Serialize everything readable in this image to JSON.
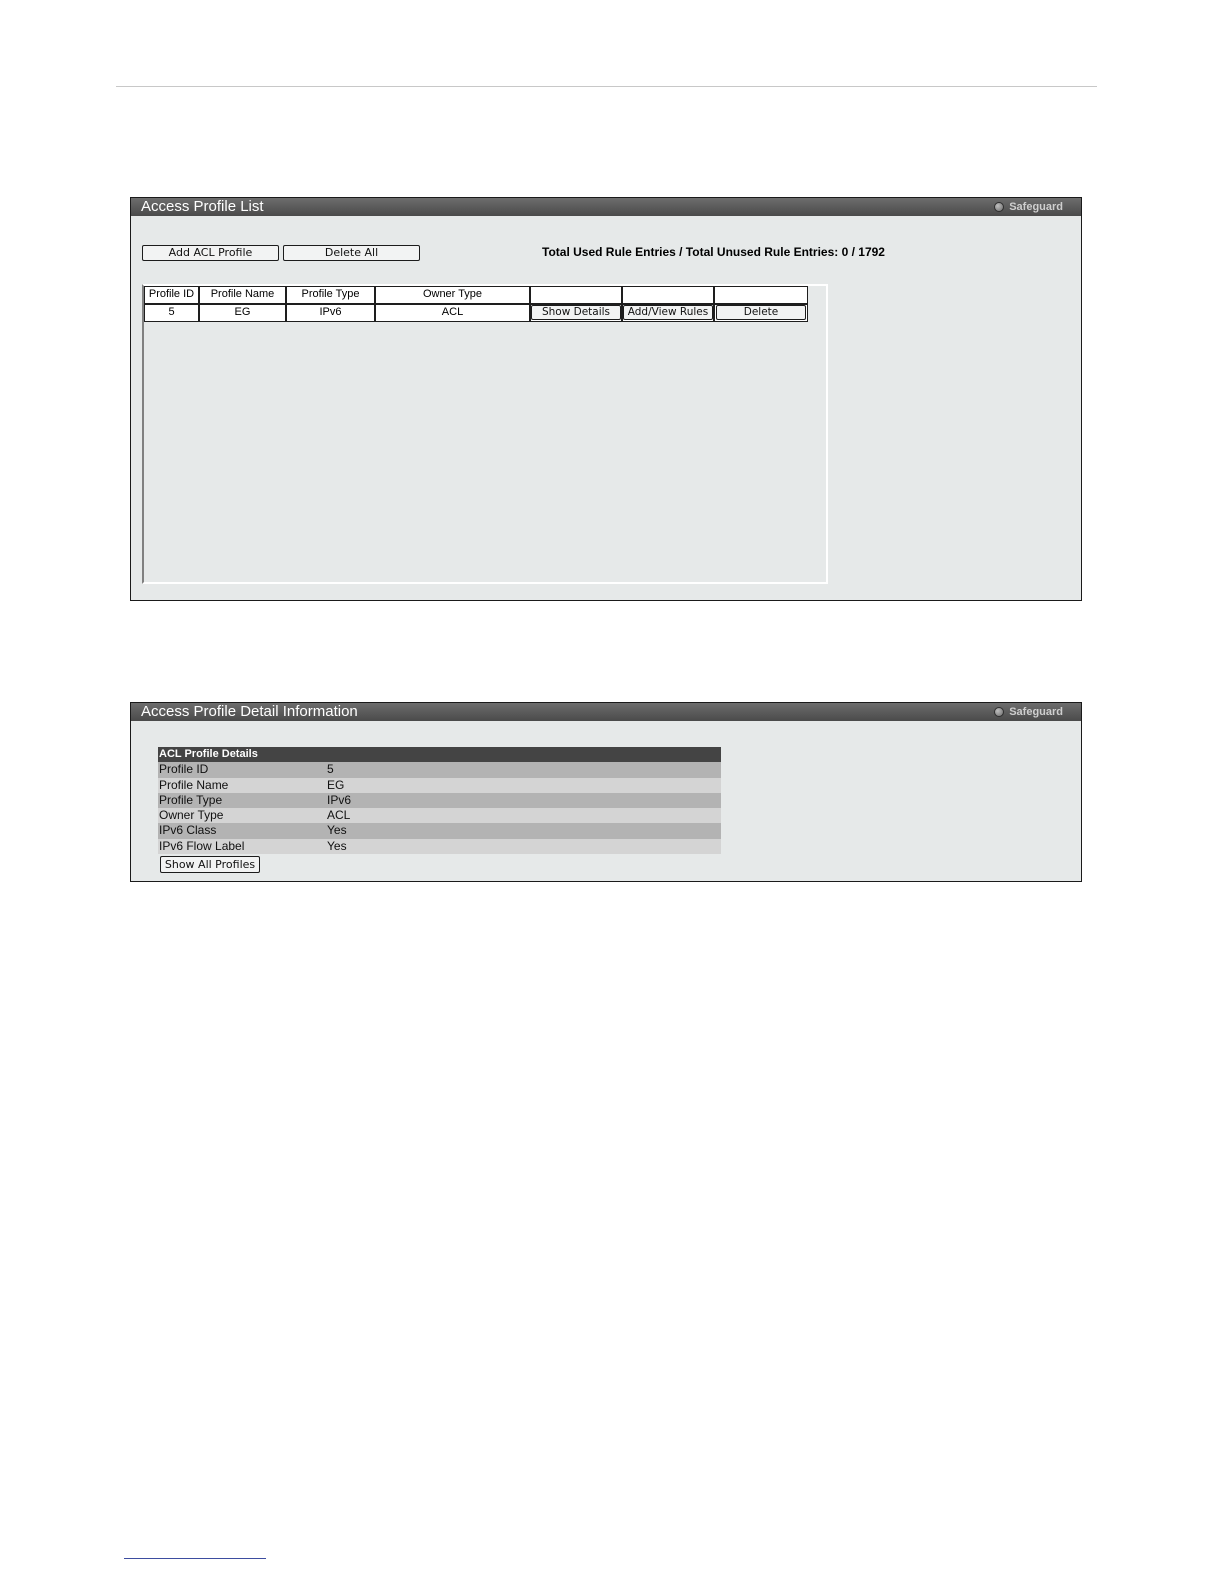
{
  "access_profile_list": {
    "title": "Access Profile List",
    "safeguard_label": "Safeguard",
    "add_button": "Add ACL Profile",
    "delete_all_button": "Delete All",
    "totals_text": "Total Used Rule Entries / Total Unused Rule Entries: 0 / 1792",
    "columns": [
      "Profile ID",
      "Profile Name",
      "Profile Type",
      "Owner Type",
      "",
      "",
      ""
    ],
    "rows": [
      {
        "profile_id": "5",
        "profile_name": "EG",
        "profile_type": "IPv6",
        "owner_type": "ACL",
        "show_details": "Show Details",
        "add_view_rules": "Add/View Rules",
        "delete": "Delete"
      }
    ]
  },
  "detail_panel": {
    "title": "Access Profile Detail Information",
    "safeguard_label": "Safeguard",
    "section_header": "ACL Profile Details",
    "rows": [
      {
        "label": "Profile ID",
        "value": "5"
      },
      {
        "label": "Profile Name",
        "value": "EG"
      },
      {
        "label": "Profile Type",
        "value": "IPv6"
      },
      {
        "label": "Owner Type",
        "value": "ACL"
      },
      {
        "label": "IPv6 Class",
        "value": "Yes"
      },
      {
        "label": "IPv6 Flow Label",
        "value": "Yes"
      }
    ],
    "show_all_button": "Show All Profiles"
  },
  "colors": {
    "panel_bg": "#e6e9e9",
    "header_bg": "#4a4a4a",
    "detail_head_bg": "#444444",
    "row_dark": "#b3b3b3",
    "row_light": "#d4d4d4"
  }
}
